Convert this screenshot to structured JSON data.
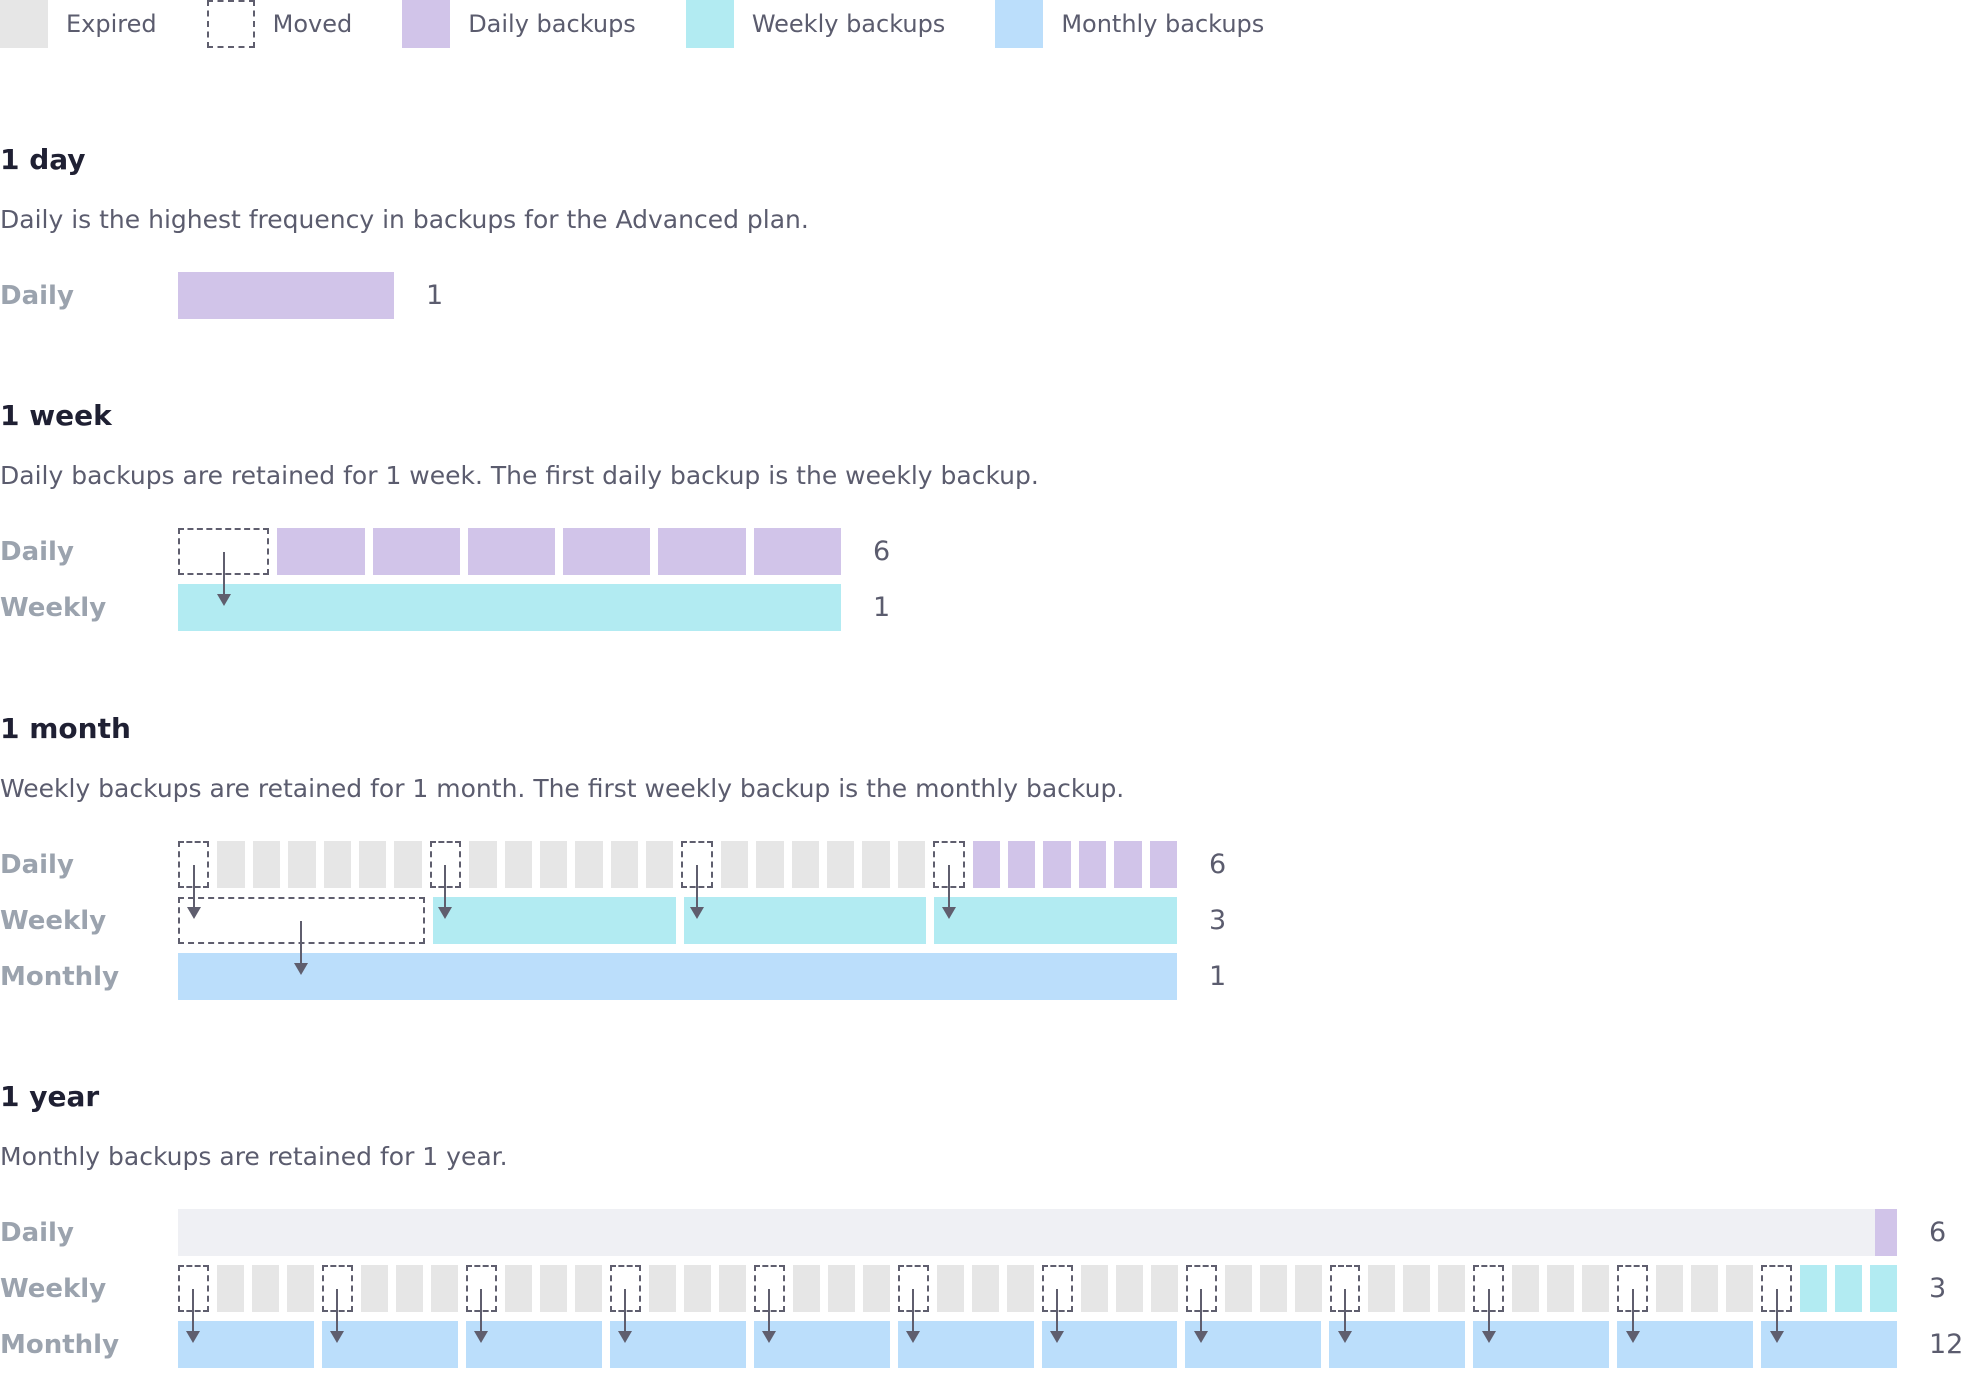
{
  "legend": [
    {
      "label": "Expired",
      "type": "expired"
    },
    {
      "label": "Moved",
      "type": "moved"
    },
    {
      "label": "Daily backups",
      "type": "daily"
    },
    {
      "label": "Weekly backups",
      "type": "weekly"
    },
    {
      "label": "Monthly backups",
      "type": "monthly"
    }
  ],
  "colors": {
    "expired": "#e6e6e6",
    "daily": "#d1c4e9",
    "weekly": "#b2ebf2",
    "monthly": "#bbdefb",
    "moved_border": "#5f5e6e"
  },
  "sections": [
    {
      "title": "1 day",
      "description": "Daily is the highest frequency in backups for the Advanced plan.",
      "rows": [
        {
          "label": "Daily",
          "count": "1",
          "cells": [
            "daily"
          ]
        }
      ]
    },
    {
      "title": "1 week",
      "description": "Daily backups are retained for 1 week. The first daily backup is the weekly backup.",
      "rows": [
        {
          "label": "Daily",
          "count": "6",
          "cells": [
            "moved",
            "daily",
            "daily",
            "daily",
            "daily",
            "daily",
            "daily"
          ]
        },
        {
          "label": "Weekly",
          "count": "1",
          "cells": [
            "weekly"
          ]
        }
      ]
    },
    {
      "title": "1 month",
      "description": "Weekly backups are retained for 1 month. The first weekly backup is the monthly backup.",
      "rows": [
        {
          "label": "Daily",
          "count": "6",
          "cells": [
            "moved",
            "expired",
            "expired",
            "expired",
            "expired",
            "expired",
            "expired",
            "moved",
            "expired",
            "expired",
            "expired",
            "expired",
            "expired",
            "expired",
            "moved",
            "expired",
            "expired",
            "expired",
            "expired",
            "expired",
            "expired",
            "moved",
            "daily",
            "daily",
            "daily",
            "daily",
            "daily",
            "daily"
          ]
        },
        {
          "label": "Weekly",
          "count": "3",
          "cells": [
            "moved",
            "weekly",
            "weekly",
            "weekly"
          ]
        },
        {
          "label": "Monthly",
          "count": "1",
          "cells": [
            "monthly"
          ]
        }
      ]
    },
    {
      "title": "1 year",
      "description": "Monthly backups are retained for 1 year.",
      "rows": [
        {
          "label": "Daily",
          "count": "6",
          "cells": [
            "expired-bar",
            "daily-sliver"
          ]
        },
        {
          "label": "Weekly",
          "count": "3",
          "cells": [
            "moved",
            "expired",
            "expired",
            "expired",
            "moved",
            "expired",
            "expired",
            "expired",
            "moved",
            "expired",
            "expired",
            "expired",
            "moved",
            "expired",
            "expired",
            "expired",
            "moved",
            "expired",
            "expired",
            "expired",
            "moved",
            "expired",
            "expired",
            "expired",
            "moved",
            "expired",
            "expired",
            "expired",
            "moved",
            "expired",
            "expired",
            "expired",
            "moved",
            "expired",
            "expired",
            "expired",
            "moved",
            "expired",
            "expired",
            "expired",
            "moved",
            "expired",
            "expired",
            "expired",
            "moved",
            "weekly",
            "weekly",
            "weekly"
          ]
        },
        {
          "label": "Monthly",
          "count": "12",
          "cells": [
            "monthly",
            "monthly",
            "monthly",
            "monthly",
            "monthly",
            "monthly",
            "monthly",
            "monthly",
            "monthly",
            "monthly",
            "monthly",
            "monthly"
          ]
        }
      ]
    }
  ]
}
